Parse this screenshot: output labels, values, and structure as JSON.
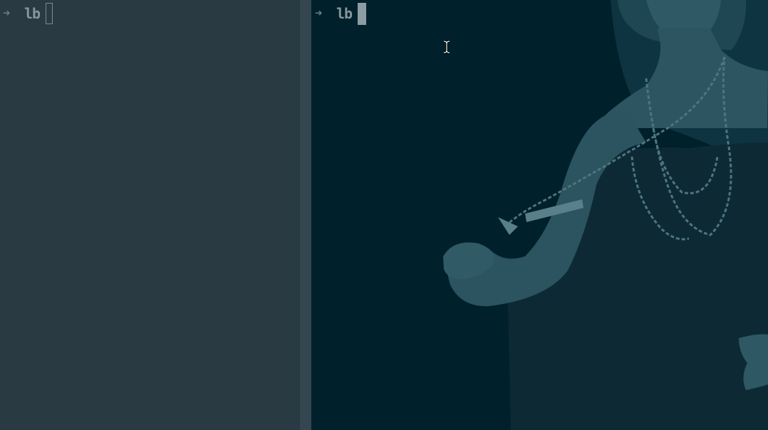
{
  "left_pane": {
    "prompt_arrow": "➜",
    "directory": "lb",
    "cursor_style": "hollow-block"
  },
  "right_pane": {
    "prompt_arrow": "➜",
    "directory": "lb",
    "cursor_style": "solid-block",
    "background_image": "woman-with-chain-necklaces"
  },
  "colors": {
    "left_bg": "#293a43",
    "divider": "#34464f",
    "right_bg": "#00202c",
    "prompt_text": "#8a969c",
    "cursor": "#8d9ca3"
  },
  "icons": {
    "prompt_arrow": "right-arrow-icon",
    "mouse_pointer": "text-ibeam-icon"
  }
}
